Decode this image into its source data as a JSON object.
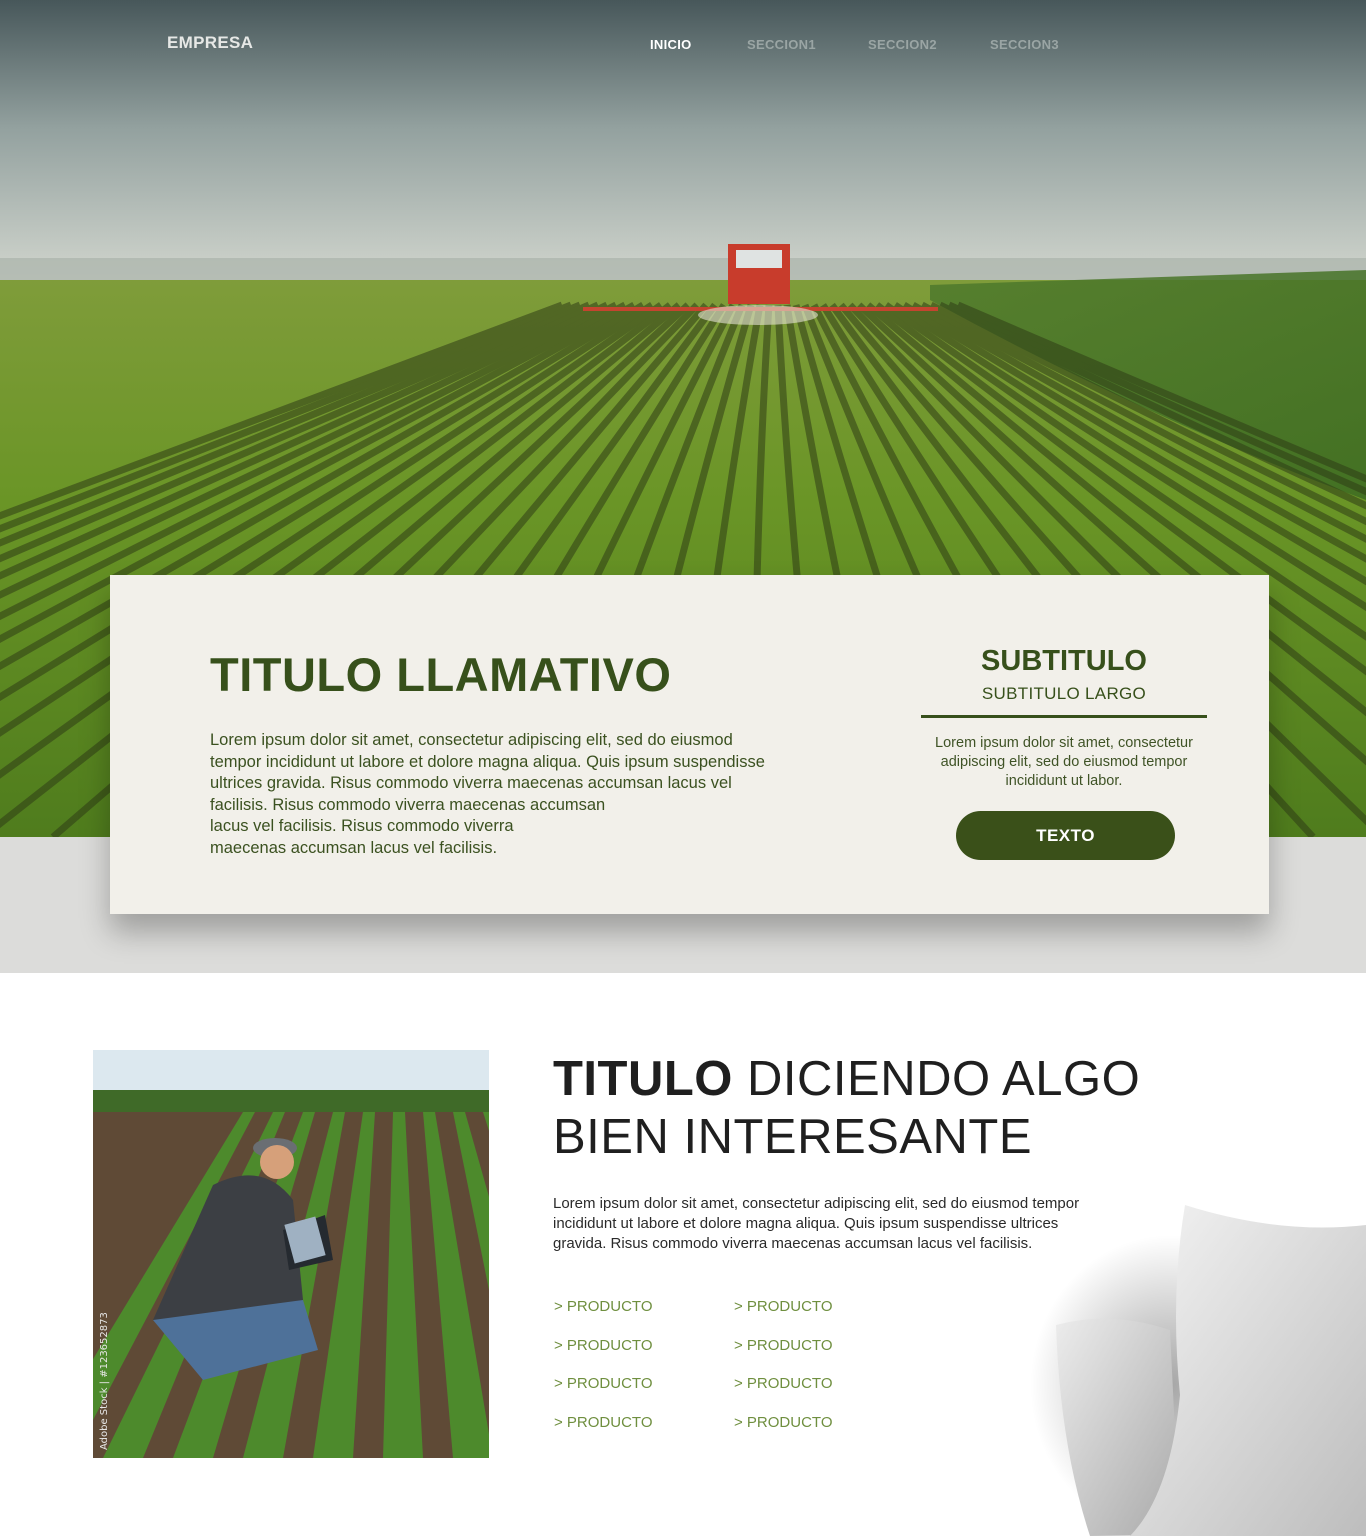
{
  "header": {
    "brand": "EMPRESA",
    "nav": [
      {
        "label": "INICIO",
        "active": true
      },
      {
        "label": "SECCION1",
        "active": false
      },
      {
        "label": "SECCION2",
        "active": false
      },
      {
        "label": "SECCION3",
        "active": false
      }
    ]
  },
  "feature": {
    "title": "TITULO LLAMATIVO",
    "body_lines": [
      "Lorem ipsum dolor sit amet, consectetur adipiscing elit, sed do eiusmod",
      "tempor incididunt ut labore et dolore magna aliqua. Quis ipsum suspendisse",
      "ultrices gravida. Risus commodo viverra maecenas accumsan lacus vel",
      "facilisis. Risus commodo viverra maecenas accumsan",
      "lacus vel facilisis. Risus commodo viverra",
      "maecenas accumsan lacus vel facilisis."
    ],
    "side": {
      "title": "SUBTITULO",
      "subtitle": "SUBTITULO LARGO",
      "text": "Lorem ipsum dolor sit amet, consectetur adipiscing elit, sed do eiusmod tempor incididunt ut labor.",
      "button": "TEXTO"
    }
  },
  "intro": {
    "title_bold": "TITULO",
    "title_light_1": "DICIENDO ALGO",
    "title_light_2": "BIEN INTERESANTE",
    "body_lines": [
      "Lorem ipsum dolor sit amet, consectetur adipiscing elit, sed do eiusmod tempor",
      "incididunt ut labore et dolore magna aliqua. Quis ipsum suspendisse ultrices",
      "gravida. Risus commodo viverra maecenas accumsan lacus vel facilisis."
    ],
    "products_col1": [
      "> PRODUCTO",
      "> PRODUCTO",
      "> PRODUCTO",
      "> PRODUCTO"
    ],
    "products_col2": [
      "> PRODUCTO",
      "> PRODUCTO",
      "> PRODUCTO",
      "> PRODUCTO"
    ],
    "photo_watermark": "Adobe Stock | #123652873"
  },
  "colors": {
    "primary_green": "#37501b",
    "card_bg": "#f2f0ea",
    "product_link": "#6f8f3f"
  }
}
